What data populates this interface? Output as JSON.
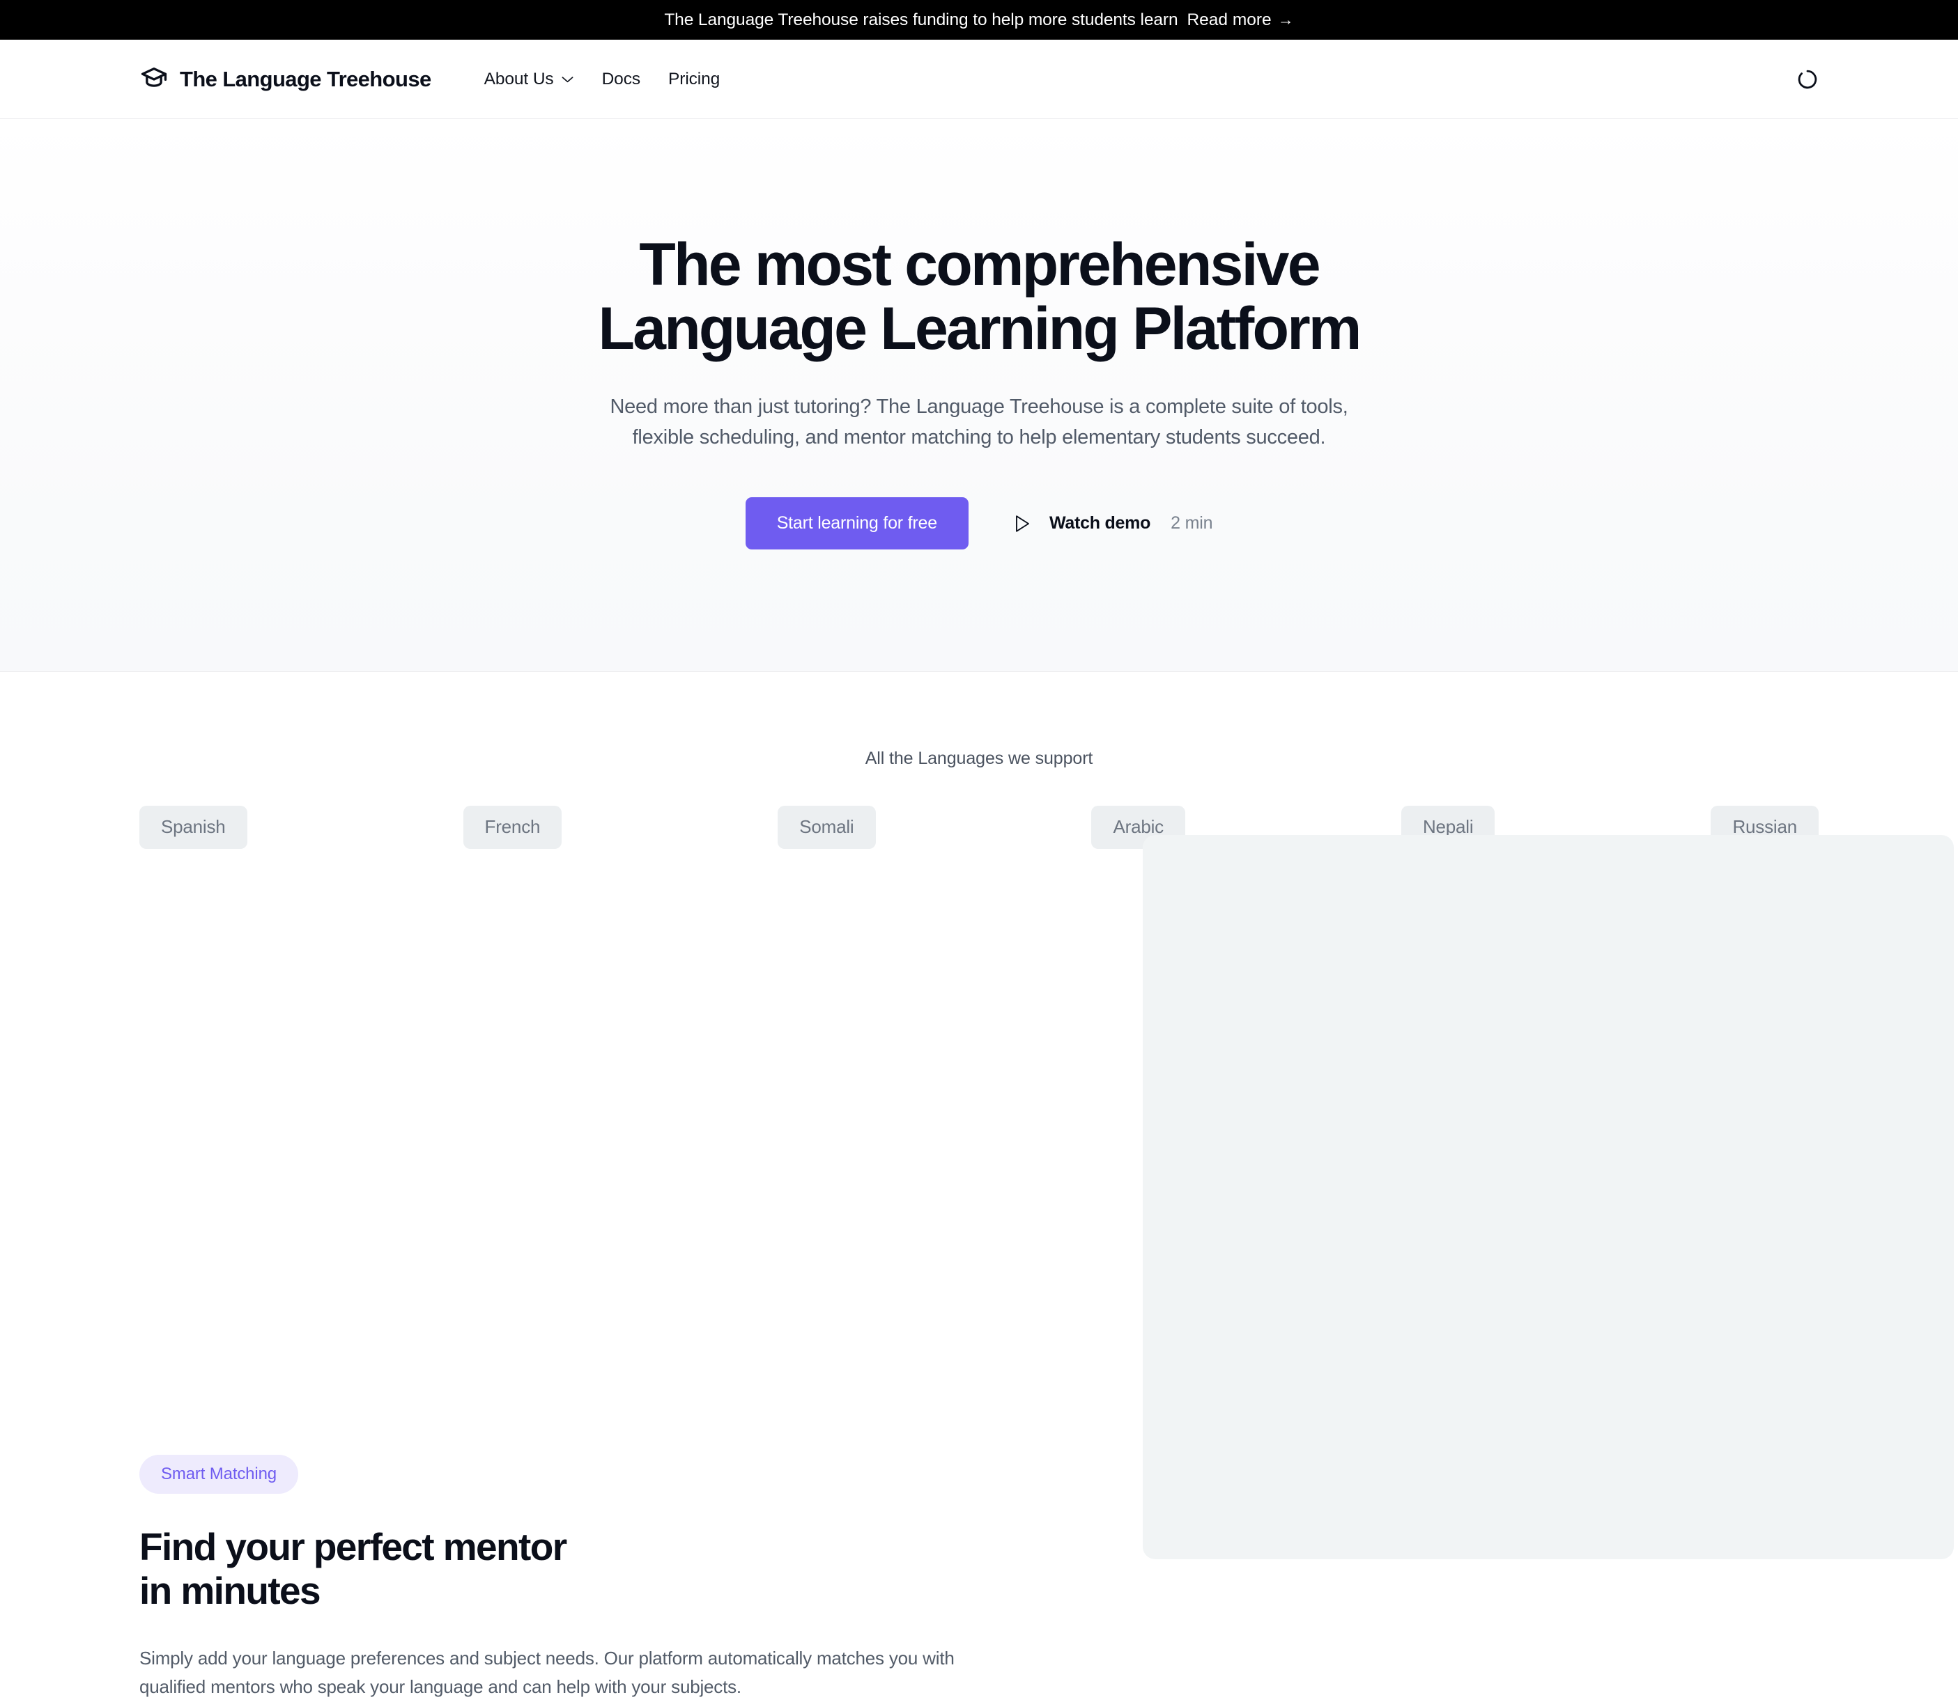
{
  "announcement": {
    "text": "The Language Treehouse raises funding to help more students learn",
    "link_label": "Read more",
    "arrow": "→"
  },
  "header": {
    "brand_name": "The Language Treehouse",
    "brand_icon": "graduation-cap-icon",
    "nav": [
      {
        "label": "About Us",
        "has_dropdown": true
      },
      {
        "label": "Docs",
        "has_dropdown": false
      },
      {
        "label": "Pricing",
        "has_dropdown": false
      }
    ],
    "status_icon": "loading-spinner-icon"
  },
  "hero": {
    "title_line_1": "The most comprehensive",
    "title_line_2": "Language Learning Platform",
    "subtitle": "Need more than just tutoring? The Language Treehouse is a complete suite of tools, flexible scheduling, and mentor matching to help elementary students succeed.",
    "primary_cta": "Start learning for free",
    "watch_demo_label": "Watch demo",
    "watch_demo_duration": "2 min",
    "play_icon": "play-triangle-icon"
  },
  "languages": {
    "caption": "All the Languages we support",
    "items": [
      "Spanish",
      "French",
      "Somali",
      "Arabic",
      "Nepali",
      "Russian"
    ]
  },
  "feature": {
    "badge": "Smart Matching",
    "title_line_1": "Find your perfect mentor",
    "title_line_2": "in minutes",
    "body": "Simply add your language preferences and subject needs. Our platform automatically matches you with qualified mentors who speak your language and can help with your subjects."
  },
  "colors": {
    "accent_purple": "#6f5cf0",
    "badge_bg": "#eeebfd",
    "chip_bg": "#eceff1",
    "banner_bg": "#000000",
    "media_placeholder_bg": "#f1f4f5",
    "text_dark": "#0b0f1a",
    "text_muted": "#525b68"
  }
}
